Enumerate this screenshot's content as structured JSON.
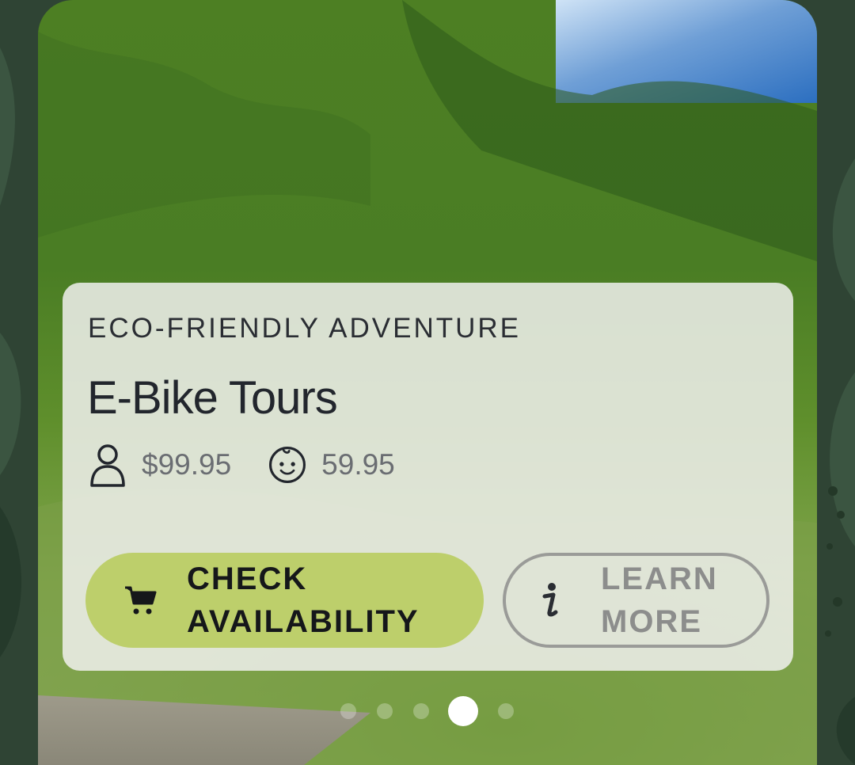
{
  "colors": {
    "backdrop": "#2f4434",
    "panel": "#f0f0ee",
    "primary_button": "#bdcf6b",
    "secondary_border": "#9a9b98",
    "title_text": "#22262d",
    "muted_text": "#6a6d72"
  },
  "card": {
    "eyebrow": "ECO-FRIENDLY ADVENTURE",
    "title": "E-Bike Tours",
    "prices": [
      {
        "icon": "adult-person-icon",
        "value": "$99.95"
      },
      {
        "icon": "child-face-icon",
        "value": "59.95"
      }
    ],
    "buttons": {
      "primary": {
        "icon": "shopping-cart-icon",
        "label": "CHECK\nAVAILABILITY"
      },
      "secondary": {
        "icon": "info-icon",
        "label": "LEARN\nMORE"
      }
    }
  },
  "carousel": {
    "slide_count": 5,
    "active_index": 3
  }
}
